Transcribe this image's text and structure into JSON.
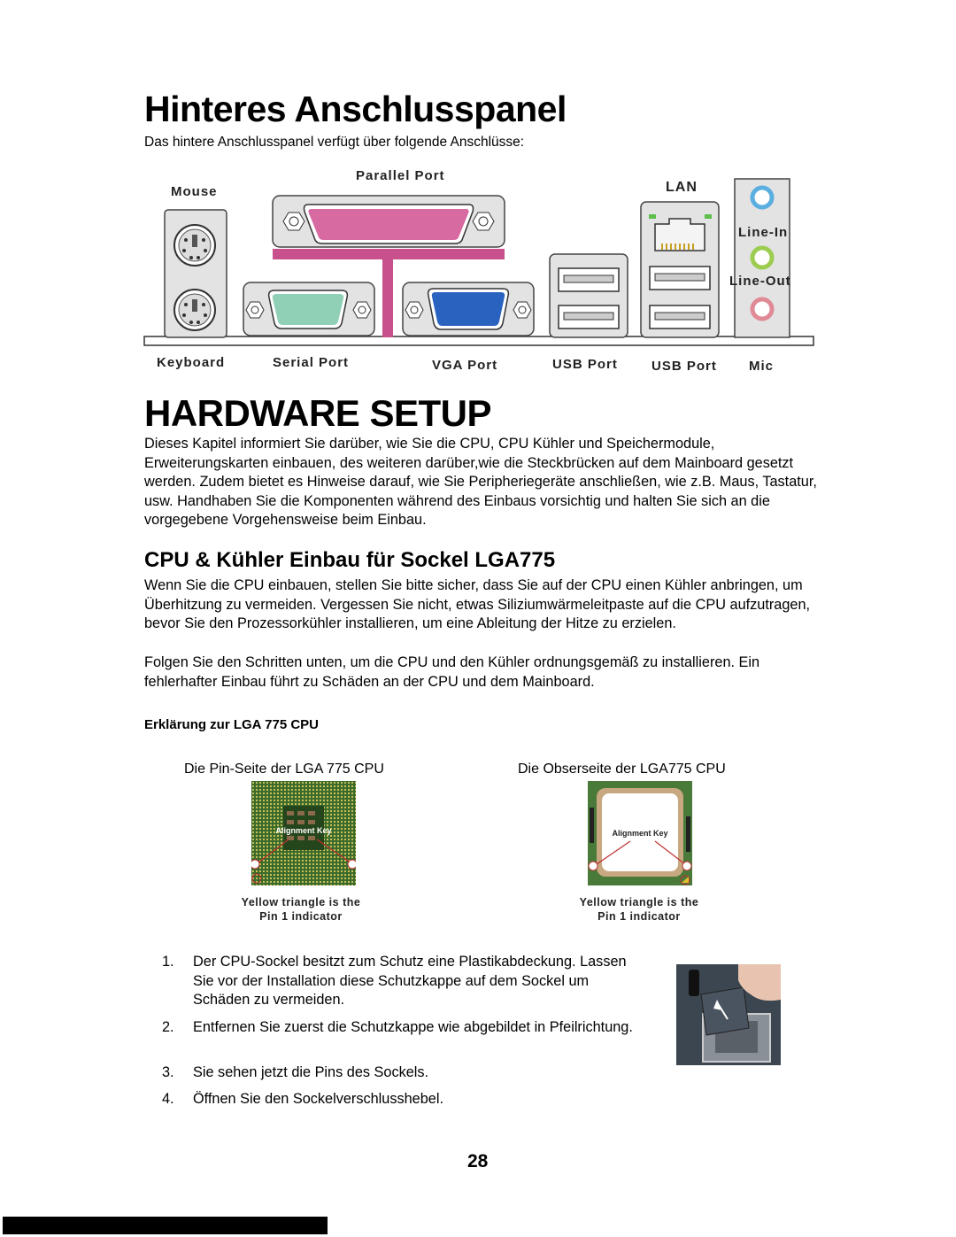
{
  "section1": {
    "title": "Hinteres Anschlusspanel",
    "intro": "Das hintere Anschlusspanel verfügt über folgende Anschlüsse:",
    "panel_labels_top": {
      "mouse": "Mouse",
      "parallel": "Parallel Port",
      "lan": "LAN",
      "line_in": "Line-In",
      "line_out": "Line-Out"
    },
    "panel_labels_bottom": {
      "keyboard": "Keyboard",
      "serial": "Serial Port",
      "vga": "VGA Port",
      "usb1": "USB Port",
      "usb2": "USB Port",
      "mic": "Mic"
    },
    "colors": {
      "parallel": "#c8508c",
      "serial": "#7cc2a8",
      "vga": "#2a62c0",
      "line_in": "#5aaee0",
      "line_out": "#9ccc50",
      "mic": "#e08a96",
      "panel_gray": "#e3e3e3"
    }
  },
  "section2": {
    "title": "HARDWARE SETUP",
    "body": "Dieses Kapitel informiert Sie darüber, wie Sie die CPU, CPU Kühler und Speichermodule, Erweiterungskarten einbauen, des weiteren darüber,wie die Steckbrücken auf dem Mainboard gesetzt werden. Zudem bietet es Hinweise darauf, wie Sie Peripheriegeräte anschließen, wie z.B. Maus, Tastatur, usw. Handhaben Sie die Komponenten während des Einbaus vorsichtig und halten Sie sich an die vorgegebene Vorgehensweise beim Einbau."
  },
  "section3": {
    "title": "CPU & Kühler Einbau für Sockel LGA775",
    "body1": "Wenn Sie die CPU einbauen, stellen Sie bitte sicher, dass Sie auf der CPU einen Kühler anbringen, um Überhitzung zu vermeiden. Vergessen Sie nicht, etwas Siliziumwärmeleitpaste auf die CPU aufzutragen, bevor Sie den Prozessorkühler installieren, um eine Ableitung der Hitze zu erzielen.",
    "body2": "Folgen Sie den Schritten unten, um die CPU und den Kühler ordnungsgemäß zu installieren. Ein fehlerhafter Einbau führt zu Schäden an der CPU und dem Mainboard.",
    "subheading": "Erklärung zur LGA 775 CPU",
    "figure_left": {
      "caption": "Die Pin-Seite der LGA 775 CPU",
      "key_label": "Alignment Key",
      "note_line1": "Yellow triangle is the",
      "note_line2": "Pin 1 indicator"
    },
    "figure_right": {
      "caption": "Die Obserseite der LGA775 CPU",
      "key_label": "Alignment Key",
      "note_line1": "Yellow triangle is the",
      "note_line2": "Pin 1 indicator"
    },
    "steps": [
      {
        "num": "1.",
        "text": "Der CPU-Sockel besitzt zum Schutz eine Plastikabdeckung. Lassen Sie vor der Installation diese Schutzkappe auf dem Sockel um Schäden zu vermeiden."
      },
      {
        "num": "2.",
        "text": "Entfernen Sie zuerst die Schutzkappe wie abgebildet in Pfeilrichtung."
      },
      {
        "num": "3.",
        "text": "Sie sehen jetzt die Pins des Sockels."
      },
      {
        "num": "4.",
        "text": "Öffnen Sie den Sockelverschlusshebel."
      }
    ]
  },
  "page_number": "28"
}
